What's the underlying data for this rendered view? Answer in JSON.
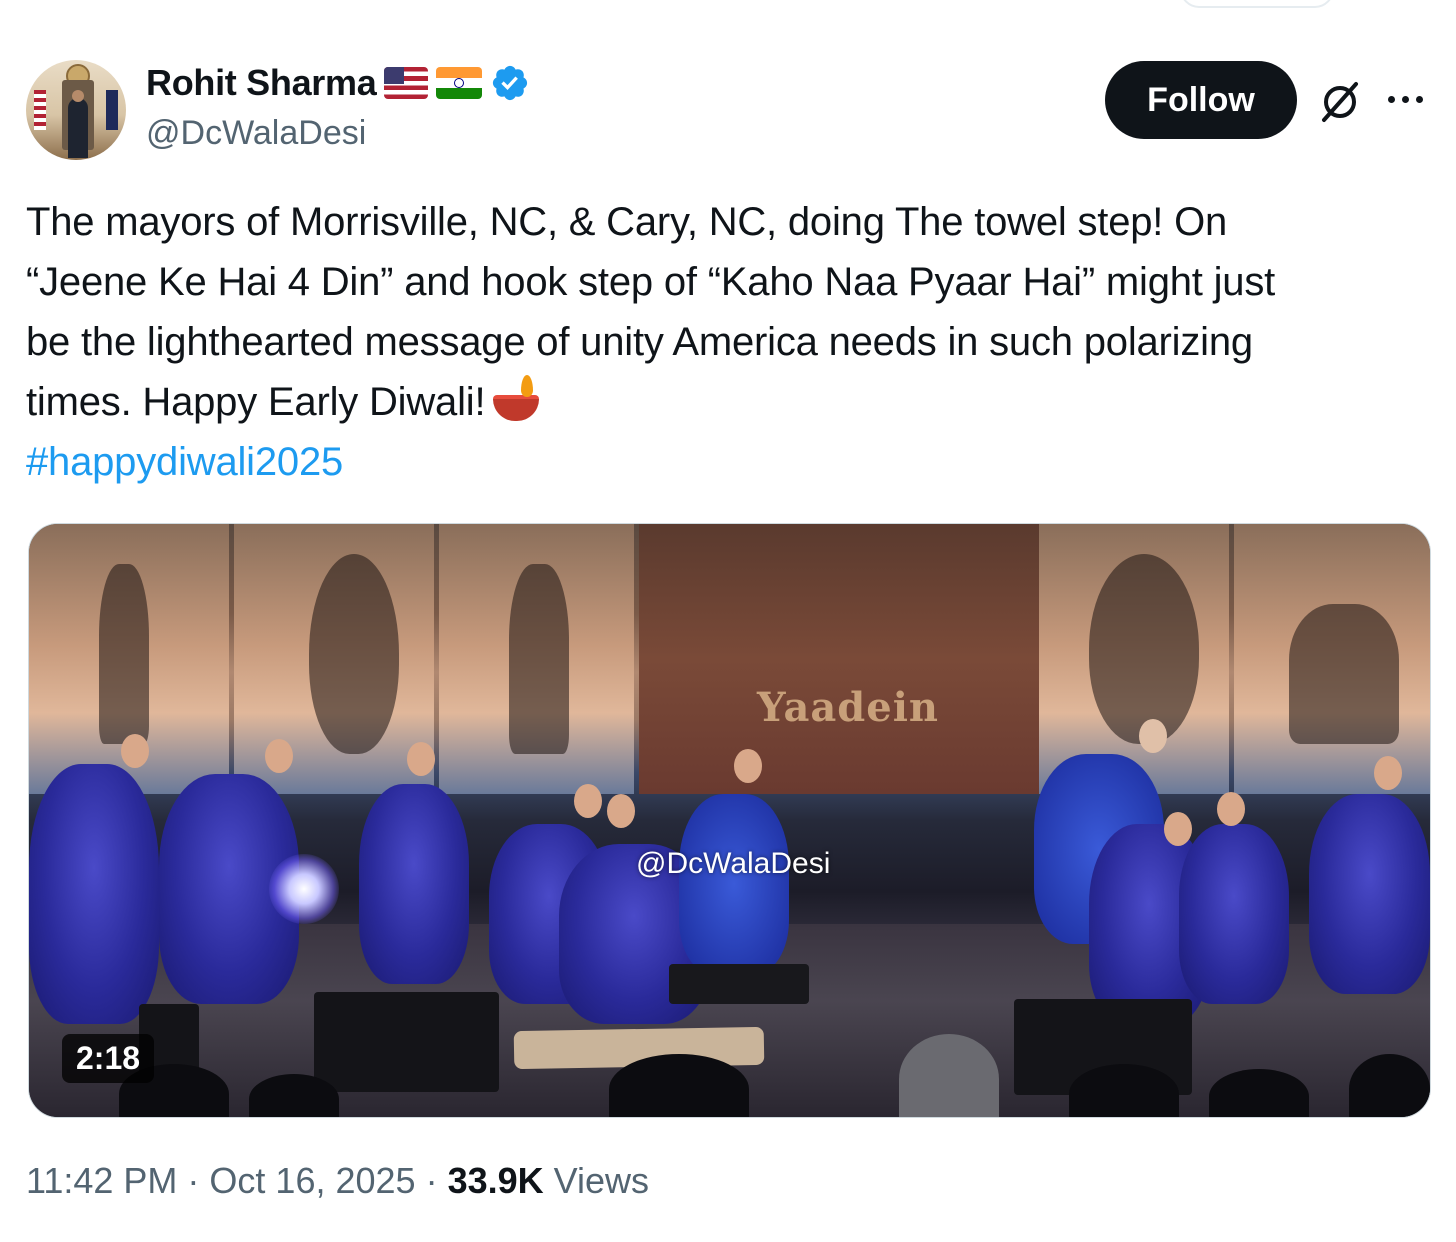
{
  "author": {
    "name": "Rohit Sharma",
    "handle": "@DcWalaDesi",
    "flags": [
      "us-flag-icon",
      "india-flag-icon"
    ],
    "verified": true
  },
  "actions": {
    "follow_label": "Follow",
    "grok_icon": "grok-icon",
    "more_icon": "more-icon"
  },
  "tweet": {
    "lines": [
      "The mayors of Morrisville, NC, & Cary, NC, doing The towel step! On",
      "“Jeene Ke Hai 4 Din” and hook step of “Kaho Naa Pyaar Hai” might just",
      "be the lighthearted message of unity America needs in such polarizing",
      "times. Happy Early Diwali!"
    ],
    "emoji": "diya-lamp-icon",
    "hashtag": "#happydiwali2025"
  },
  "media": {
    "type": "video",
    "duration": "2:18",
    "watermark": "@DcWalaDesi",
    "banner_text": "Yaadein"
  },
  "meta": {
    "time": "11:42 PM",
    "separator": "·",
    "date": "Oct 16, 2025",
    "views_count": "33.9K",
    "views_label": "Views"
  },
  "colors": {
    "text": "#0f1419",
    "secondary": "#536471",
    "link": "#1d9bf0",
    "verified": "#1d9bf0",
    "follow_bg": "#0f1419"
  }
}
